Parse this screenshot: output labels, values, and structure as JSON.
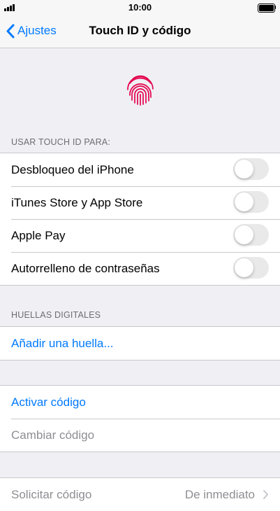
{
  "status_bar": {
    "time": "10:00"
  },
  "nav": {
    "back_label": "Ajustes",
    "title": "Touch ID y código"
  },
  "colors": {
    "accent": "#007aff",
    "fingerprint": "#e4004b",
    "toggle_off": "#e9e9ea"
  },
  "touch_id": {
    "icon": "fingerprint-icon",
    "section_header": "USAR TOUCH ID PARA:",
    "items": [
      {
        "label": "Desbloqueo del iPhone",
        "toggle_on": false
      },
      {
        "label": "iTunes Store y App Store",
        "toggle_on": false
      },
      {
        "label": "Apple Pay",
        "toggle_on": false
      },
      {
        "label": "Autorrelleno de contraseñas",
        "toggle_on": false
      }
    ]
  },
  "fingerprints": {
    "section_header": "HUELLAS DIGITALES",
    "add_label": "Añadir una huella..."
  },
  "passcode": {
    "activate_label": "Activar código",
    "change_label": "Cambiar código"
  },
  "require_passcode": {
    "label": "Solicitar código",
    "value": "De inmediato"
  }
}
